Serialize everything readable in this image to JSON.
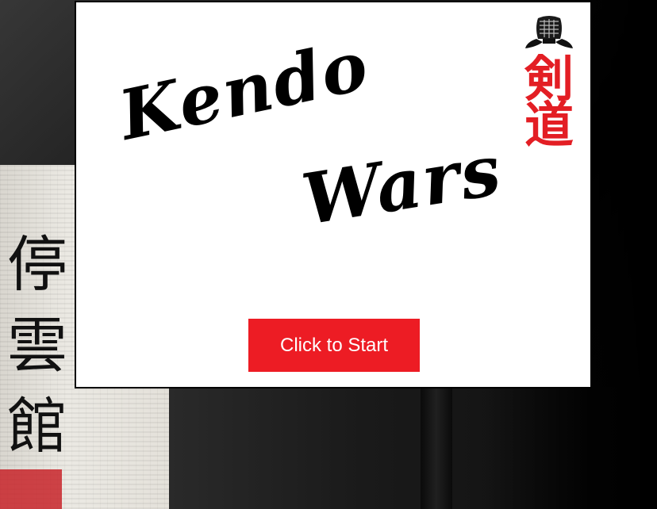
{
  "game": {
    "title_line_1": "Kendo",
    "title_line_2": "Wars",
    "start_button_label": "Click to Start",
    "accent_color": "#ed1c24"
  },
  "logo": {
    "icon": "kendo-mask-icon",
    "kanji_top": "剣",
    "kanji_bottom": "道"
  },
  "background": {
    "scroll_kanji": [
      "停",
      "雲",
      "館"
    ]
  }
}
